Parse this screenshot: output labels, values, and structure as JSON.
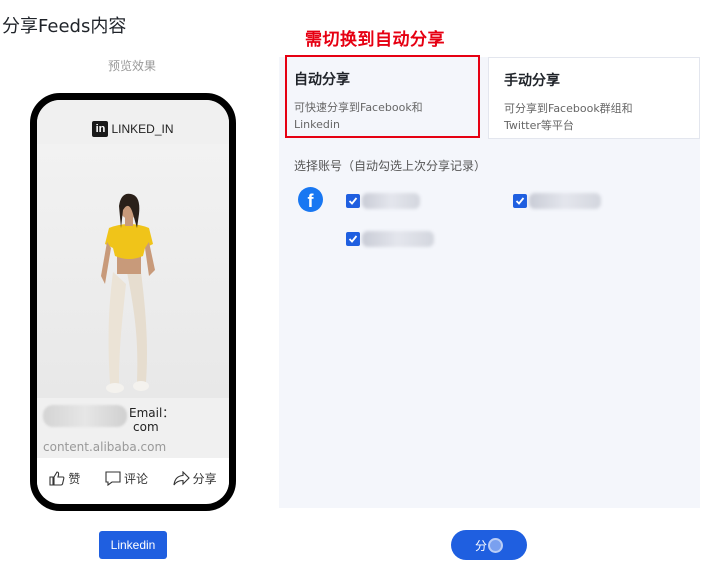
{
  "page": {
    "title": "分享Feeds内容",
    "preview_label": "预览效果"
  },
  "annotation": "需切换到自动分享",
  "phone": {
    "header_label": "LINKED_IN",
    "logo_text": "in",
    "email_label": "Email：",
    "email_tail": "com",
    "domain": "content.alibaba.com",
    "actions": [
      {
        "label": "赞",
        "icon": "thumbs-up-icon"
      },
      {
        "label": "评论",
        "icon": "comment-icon"
      },
      {
        "label": "分享",
        "icon": "share-arrow-icon"
      }
    ]
  },
  "platform_button": "Linkedin",
  "share_mode": {
    "auto": {
      "title": "自动分享",
      "desc_line1": "可快速分享到Facebook和",
      "desc_line2": "Linkedin"
    },
    "manual": {
      "title": "手动分享",
      "desc_line1": "可分享到Facebook群组和",
      "desc_line2": "Twitter等平台"
    }
  },
  "accounts": {
    "label": "选择账号（自动勾选上次分享记录）",
    "facebook_icon": "f",
    "checked": [
      true,
      true,
      true
    ]
  },
  "share_button": {
    "label": "分"
  },
  "colors": {
    "accent": "#1f5fe0",
    "annotation": "#e60012",
    "facebook": "#1877f2",
    "panel_bg": "#f4f6fb"
  }
}
